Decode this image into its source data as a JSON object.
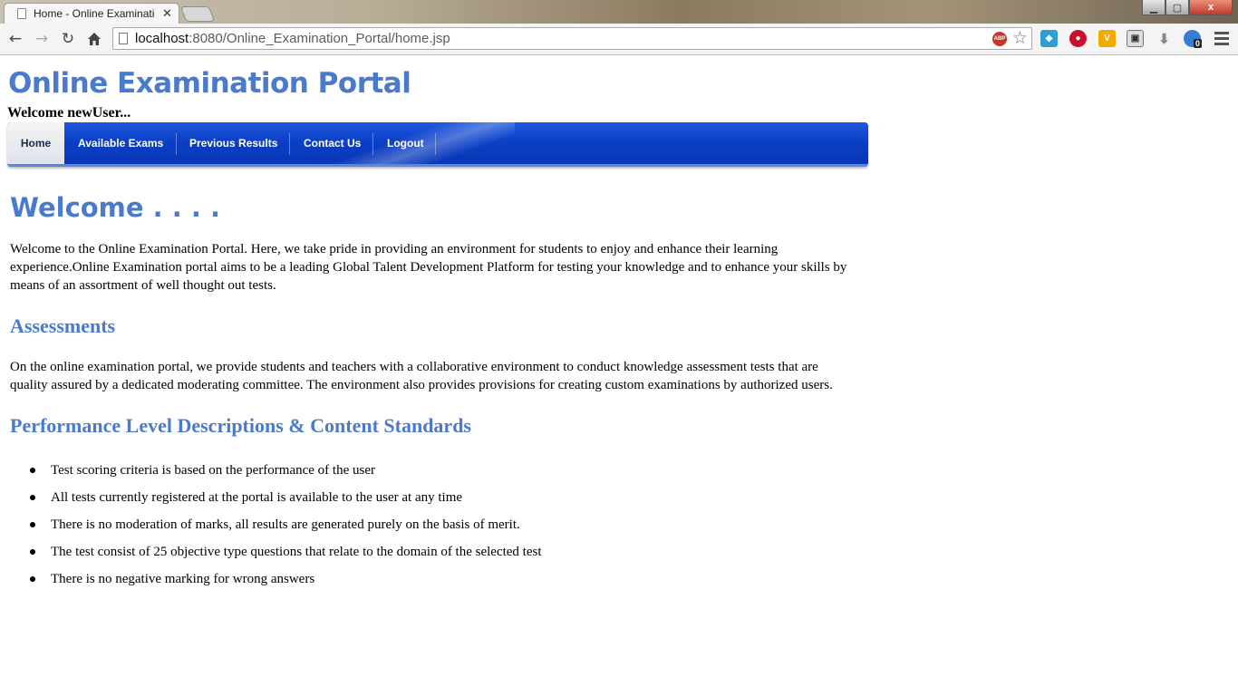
{
  "browser": {
    "tab_title": "Home - Online Examinatic",
    "tab_close": "✕",
    "url_host": "localhost",
    "url_rest": ":8080/Online_Examination_Portal/home.jsp",
    "window_close": "x",
    "extensions": {
      "abp_label": "ABP",
      "badge_count": "0"
    }
  },
  "site": {
    "title": "Online Examination Portal",
    "welcome_user": "Welcome newUser..."
  },
  "nav": {
    "items": [
      {
        "label": "Home"
      },
      {
        "label": "Available Exams"
      },
      {
        "label": "Previous Results"
      },
      {
        "label": "Contact Us"
      },
      {
        "label": "Logout"
      }
    ]
  },
  "content": {
    "heading": "Welcome . . . .",
    "intro": "Welcome to the Online Examination Portal. Here, we take pride in providing an environment for students to enjoy and enhance their learning experience.Online Examination portal aims to be a leading Global Talent Development Platform for testing your knowledge and to enhance your skills by means of an assortment of well thought out tests.",
    "assessments_heading": "Assessments",
    "assessments_text": "On the online examination portal, we provide students and teachers with a collaborative environment to conduct knowledge assessment tests that are quality assured by a dedicated moderating committee. The environment also provides provisions for creating custom examinations by authorized users.",
    "performance_heading": "Performance Level Descriptions & Content Standards",
    "bullets": [
      "Test scoring criteria is based on the performance of the user",
      "All tests currently registered at the portal is available to the user at any time",
      "There is no moderation of marks, all results are generated purely on the basis of merit.",
      "The test consist of 25 objective type questions that relate to the domain of the selected test",
      "There is no negative marking for wrong answers"
    ]
  }
}
